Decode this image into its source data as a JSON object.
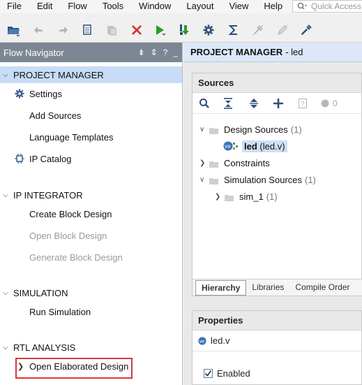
{
  "menubar": {
    "items": [
      "File",
      "Edit",
      "Flow",
      "Tools",
      "Window",
      "Layout",
      "View",
      "Help"
    ],
    "quick_access_placeholder": "Quick Access"
  },
  "toolbar": {
    "buttons": [
      "open-project-icon",
      "undo-icon",
      "redo-icon",
      "copy-icon",
      "paste-icon",
      "delete-icon",
      "run-icon",
      "download-icon",
      "settings-icon",
      "sigma-icon",
      "no-pin-icon",
      "pen-icon",
      "wrench-icon"
    ]
  },
  "flow_navigator": {
    "title": "Flow Navigator",
    "header_controls": [
      "⇟",
      "⇕",
      "?",
      "_"
    ],
    "sections": [
      {
        "title": "PROJECT MANAGER",
        "expanded": true,
        "active": true,
        "items": [
          {
            "label": "Settings",
            "icon": "gear-icon",
            "disabled": false
          },
          {
            "label": "Add Sources",
            "disabled": false
          },
          {
            "label": "Language Templates",
            "disabled": false
          },
          {
            "label": "IP Catalog",
            "icon": "ip-catalog-icon",
            "disabled": false
          }
        ]
      },
      {
        "title": "IP INTEGRATOR",
        "expanded": true,
        "items": [
          {
            "label": "Create Block Design",
            "disabled": false
          },
          {
            "label": "Open Block Design",
            "disabled": true
          },
          {
            "label": "Generate Block Design",
            "disabled": true
          }
        ]
      },
      {
        "title": "SIMULATION",
        "expanded": true,
        "items": [
          {
            "label": "Run Simulation",
            "disabled": false
          }
        ]
      },
      {
        "title": "RTL ANALYSIS",
        "expanded": true,
        "items": [
          {
            "label": "Open Elaborated Design",
            "disabled": false,
            "highlighted": true
          }
        ]
      }
    ]
  },
  "project_manager": {
    "header_bold": "PROJECT MANAGER",
    "header_rest": "- led"
  },
  "sources": {
    "title": "Sources",
    "counter": "0",
    "tree": {
      "design_sources": {
        "label": "Design Sources",
        "count": "(1)"
      },
      "led": {
        "name": "led",
        "file": "(led.v)",
        "badge": "ve"
      },
      "constraints": {
        "label": "Constraints"
      },
      "simulation_sources": {
        "label": "Simulation Sources",
        "count": "(1)"
      },
      "sim_1": {
        "label": "sim_1",
        "count": "(1)"
      }
    },
    "tabs": [
      "Hierarchy",
      "Libraries",
      "Compile Order"
    ]
  },
  "properties": {
    "title": "Properties",
    "file": "led.v",
    "file_badge": "ve",
    "enabled_label": "Enabled",
    "enabled_checked": true
  }
}
